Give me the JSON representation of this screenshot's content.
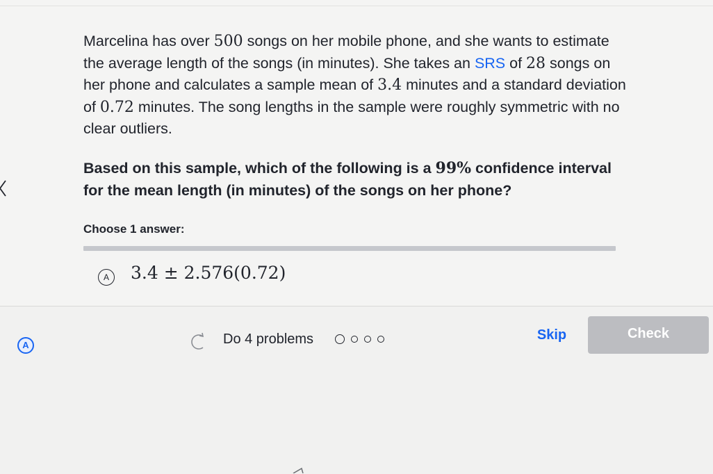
{
  "exercise": {
    "passage": {
      "p1": "Marcelina has over ",
      "count": "500",
      "p2": " songs on her mobile phone, and she wants to estimate the average length of the songs (in minutes). She takes an ",
      "srs": "SRS",
      "p3": " of ",
      "n": "28",
      "p4": " songs on her phone and calculates a sample mean of ",
      "mean": "3.4",
      "p5": " minutes and a standard deviation of ",
      "sd": "0.72",
      "p6": " minutes. The song lengths in the sample were roughly symmetric with no clear outliers."
    },
    "question": {
      "q1": "Based on this sample, which of the following is a ",
      "level": "99%",
      "q2": " confidence interval for the mean length (in minutes) of the songs on her phone?"
    },
    "choose_label": "Choose 1 answer:",
    "choices": [
      {
        "letter": "A",
        "text": "3.4 ± 2.576(0.72)"
      }
    ]
  },
  "footer": {
    "user_badge": "A",
    "do_problems_label": "Do 4 problems",
    "progress_total": 4,
    "progress_completed": 0,
    "skip_label": "Skip",
    "check_label": "Check"
  },
  "colors": {
    "accent": "#1865f2",
    "check_disabled": "#bcbdc1",
    "text": "#21242c"
  },
  "icons": [
    "chevron-left-icon",
    "refresh-icon",
    "progress-dot-icon"
  ]
}
